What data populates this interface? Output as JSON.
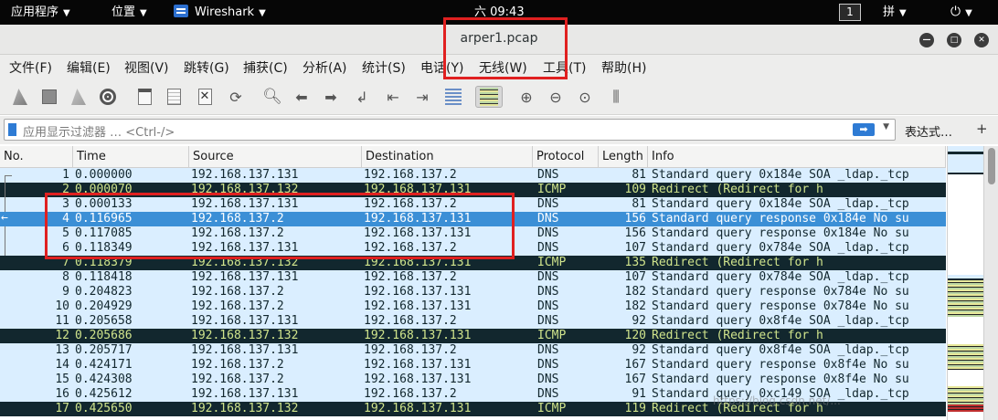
{
  "topbar": {
    "apps": "应用程序",
    "places": "位置",
    "app_name": "Wireshark",
    "clock": "六 09:43",
    "workspace": "1",
    "input_method": "拼",
    "power_icon": "power-icon"
  },
  "window": {
    "title": "arper1.pcap",
    "minimize": "minimize-icon",
    "maximize": "maximize-icon",
    "close": "close-icon"
  },
  "menu": [
    "文件(F)",
    "编辑(E)",
    "视图(V)",
    "跳转(G)",
    "捕获(C)",
    "分析(A)",
    "统计(S)",
    "电话(Y)",
    "无线(W)",
    "工具(T)",
    "帮助(H)"
  ],
  "toolbar": [
    "start-capture-icon",
    "stop-capture-icon",
    "restart-capture-icon",
    "capture-options-icon",
    "open-file-icon",
    "save-file-icon",
    "close-file-icon",
    "reload-icon",
    "find-packet-icon",
    "go-back-icon",
    "go-forward-icon",
    "go-to-packet-icon",
    "first-packet-icon",
    "last-packet-icon",
    "auto-scroll-icon",
    "colorize-icon",
    "zoom-in-icon",
    "zoom-out-icon",
    "normal-size-icon",
    "resize-columns-icon"
  ],
  "filter": {
    "placeholder": "应用显示过滤器 … <Ctrl-/>",
    "expression_label": "表达式…",
    "add_label": "+"
  },
  "columns": [
    "No.",
    "Time",
    "Source",
    "Destination",
    "Protocol",
    "Length",
    "Info"
  ],
  "packets": [
    {
      "no": "1",
      "time": "0.000000",
      "src": "192.168.137.131",
      "dst": "192.168.137.2",
      "proto": "DNS",
      "len": "81",
      "info": "Standard query 0x184e SOA _ldap._tcp"
    },
    {
      "no": "2",
      "time": "0.000070",
      "src": "192.168.137.132",
      "dst": "192.168.137.131",
      "proto": "ICMP",
      "len": "109",
      "info": "Redirect          (Redirect for h"
    },
    {
      "no": "3",
      "time": "0.000133",
      "src": "192.168.137.131",
      "dst": "192.168.137.2",
      "proto": "DNS",
      "len": "81",
      "info": "Standard query 0x184e SOA _ldap._tcp"
    },
    {
      "no": "4",
      "time": "0.116965",
      "src": "192.168.137.2",
      "dst": "192.168.137.131",
      "proto": "DNS",
      "len": "156",
      "info": "Standard query response 0x184e No su"
    },
    {
      "no": "5",
      "time": "0.117085",
      "src": "192.168.137.2",
      "dst": "192.168.137.131",
      "proto": "DNS",
      "len": "156",
      "info": "Standard query response 0x184e No su"
    },
    {
      "no": "6",
      "time": "0.118349",
      "src": "192.168.137.131",
      "dst": "192.168.137.2",
      "proto": "DNS",
      "len": "107",
      "info": "Standard query 0x784e SOA _ldap._tcp"
    },
    {
      "no": "7",
      "time": "0.118379",
      "src": "192.168.137.132",
      "dst": "192.168.137.131",
      "proto": "ICMP",
      "len": "135",
      "info": "Redirect          (Redirect for h"
    },
    {
      "no": "8",
      "time": "0.118418",
      "src": "192.168.137.131",
      "dst": "192.168.137.2",
      "proto": "DNS",
      "len": "107",
      "info": "Standard query 0x784e SOA _ldap._tcp"
    },
    {
      "no": "9",
      "time": "0.204823",
      "src": "192.168.137.2",
      "dst": "192.168.137.131",
      "proto": "DNS",
      "len": "182",
      "info": "Standard query response 0x784e No su"
    },
    {
      "no": "10",
      "time": "0.204929",
      "src": "192.168.137.2",
      "dst": "192.168.137.131",
      "proto": "DNS",
      "len": "182",
      "info": "Standard query response 0x784e No su"
    },
    {
      "no": "11",
      "time": "0.205658",
      "src": "192.168.137.131",
      "dst": "192.168.137.2",
      "proto": "DNS",
      "len": "92",
      "info": "Standard query 0x8f4e SOA _ldap._tcp"
    },
    {
      "no": "12",
      "time": "0.205686",
      "src": "192.168.137.132",
      "dst": "192.168.137.131",
      "proto": "ICMP",
      "len": "120",
      "info": "Redirect          (Redirect for h"
    },
    {
      "no": "13",
      "time": "0.205717",
      "src": "192.168.137.131",
      "dst": "192.168.137.2",
      "proto": "DNS",
      "len": "92",
      "info": "Standard query 0x8f4e SOA _ldap._tcp"
    },
    {
      "no": "14",
      "time": "0.424171",
      "src": "192.168.137.2",
      "dst": "192.168.137.131",
      "proto": "DNS",
      "len": "167",
      "info": "Standard query response 0x8f4e No su"
    },
    {
      "no": "15",
      "time": "0.424308",
      "src": "192.168.137.2",
      "dst": "192.168.137.131",
      "proto": "DNS",
      "len": "167",
      "info": "Standard query response 0x8f4e No su"
    },
    {
      "no": "16",
      "time": "0.425612",
      "src": "192.168.137.131",
      "dst": "192.168.137.2",
      "proto": "DNS",
      "len": "91",
      "info": "Standard query 0xc149 SOA _ldap._tcp"
    },
    {
      "no": "17",
      "time": "0.425650",
      "src": "192.168.137.132",
      "dst": "192.168.137.131",
      "proto": "ICMP",
      "len": "119",
      "info": "Redirect          (Redirect for h"
    }
  ],
  "selected_packet": "4",
  "watermark": "https://blog.csdn.net/...",
  "colors": {
    "dns_row": "#daeeff",
    "icmp_row": "#12272e",
    "icmp_text": "#d0e48c",
    "selected_row": "#3b8fd6",
    "annotation": "#e02020"
  }
}
